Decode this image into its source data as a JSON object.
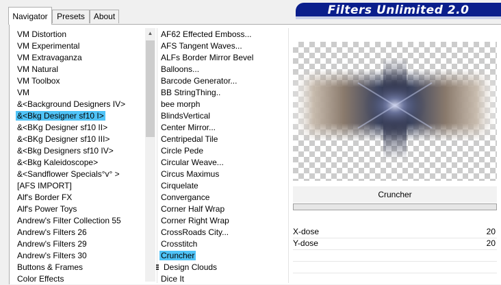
{
  "tabs": [
    {
      "label": "Navigator",
      "active": true
    },
    {
      "label": "Presets",
      "active": false
    },
    {
      "label": "About",
      "active": false
    }
  ],
  "banner": {
    "title": "Filters Unlimited 2.0"
  },
  "categories": {
    "selected_index": 7,
    "items": [
      "VM Distortion",
      "VM Experimental",
      "VM Extravaganza",
      "VM Natural",
      "VM Toolbox",
      "VM",
      "&<Background Designers IV>",
      "&<Bkg Designer sf10 I>",
      "&<BKg Designer sf10 II>",
      "&<BKg Designer sf10 III>",
      "&<Bkg Designers sf10 IV>",
      "&<Bkg Kaleidoscope>",
      "&<Sandflower Specials°v° >",
      "[AFS IMPORT]",
      "Alf's Border FX",
      "Alf's Power Toys",
      "Andrew's Filter Collection 55",
      "Andrew's Filters 26",
      "Andrew's Filters 29",
      "Andrew's Filters 30",
      "Buttons & Frames",
      "Color Effects"
    ]
  },
  "filters": {
    "selected_index": 19,
    "items": [
      "AF62 Effected Emboss...",
      "AFS Tangent Waves...",
      "ALFs Border Mirror Bevel",
      "Balloons...",
      "Barcode Generator...",
      "BB StringThing..",
      "bee morph",
      "BlindsVertical",
      "Center Mirror...",
      "Centripedal Tile",
      "Circle Pede",
      "Circular Weave...",
      "Circus Maximus",
      "Cirquelate",
      "Convergance",
      "Corner Half Wrap",
      "Corner Right Wrap",
      "CrossRoads City...",
      "Crosstitch",
      "Cruncher",
      "Design Clouds",
      "Dice It"
    ]
  },
  "preview": {
    "filter_name": "Cruncher"
  },
  "params": [
    {
      "label": "X-dose",
      "value": "20"
    },
    {
      "label": "Y-dose",
      "value": "20"
    }
  ],
  "colors": {
    "selection": "#4fc3f7",
    "banner_bg": "#0a1e8c"
  }
}
